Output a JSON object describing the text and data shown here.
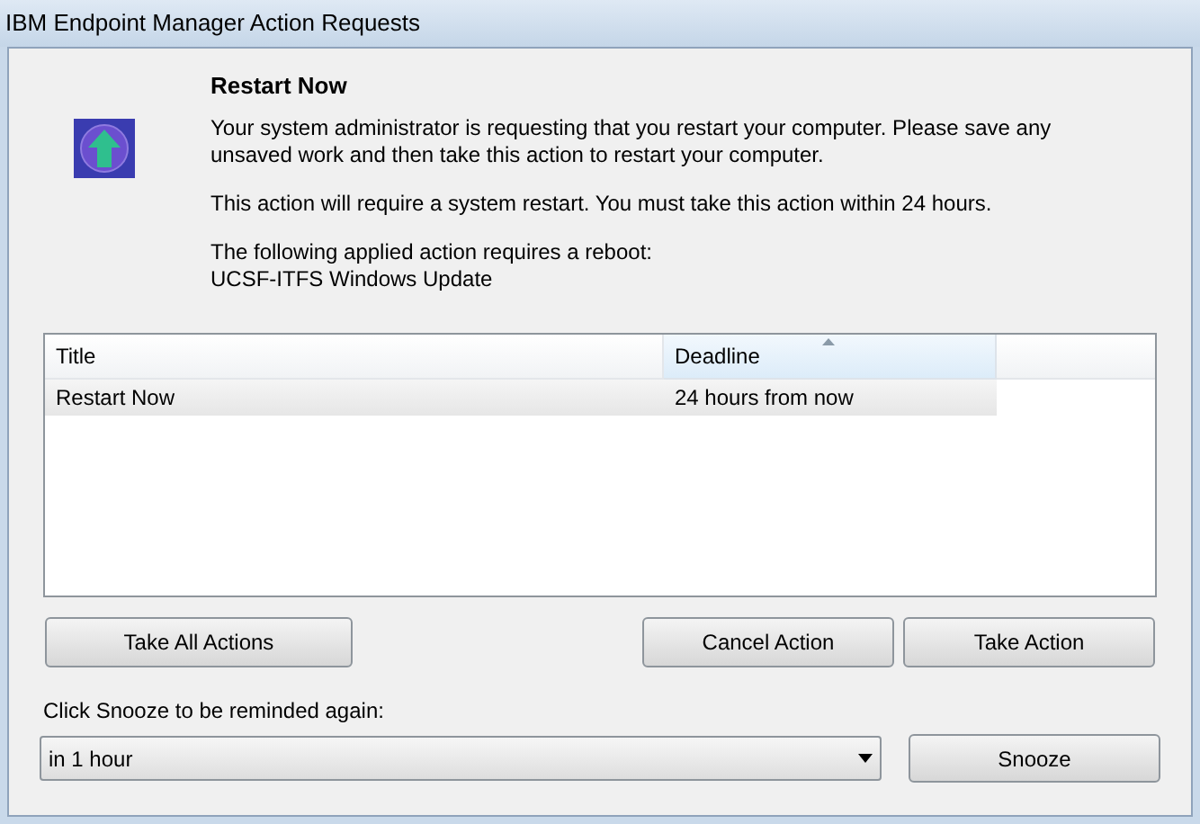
{
  "window": {
    "title": "IBM Endpoint Manager Action Requests"
  },
  "action": {
    "heading": "Restart Now",
    "paragraphs": [
      "Your system administrator is requesting that you restart your computer.  Please save any unsaved work and then take this action to restart your computer.",
      "This action will require a system restart.  You must take this action within 24 hours.",
      "The following applied action requires a reboot:\nUCSF-ITFS Windows Update"
    ]
  },
  "table": {
    "columns": [
      {
        "label": "Title",
        "sorted": false
      },
      {
        "label": "Deadline",
        "sorted": true
      }
    ],
    "rows": [
      {
        "cells": [
          "Restart Now",
          "24 hours from now"
        ],
        "selected": true
      }
    ]
  },
  "buttons": {
    "left": [
      "Take All Actions"
    ],
    "right": [
      "Cancel Action",
      "Take Action"
    ]
  },
  "snooze": {
    "label": "Click Snooze to be reminded again:",
    "value": "in 1 hour",
    "button": "Snooze"
  }
}
